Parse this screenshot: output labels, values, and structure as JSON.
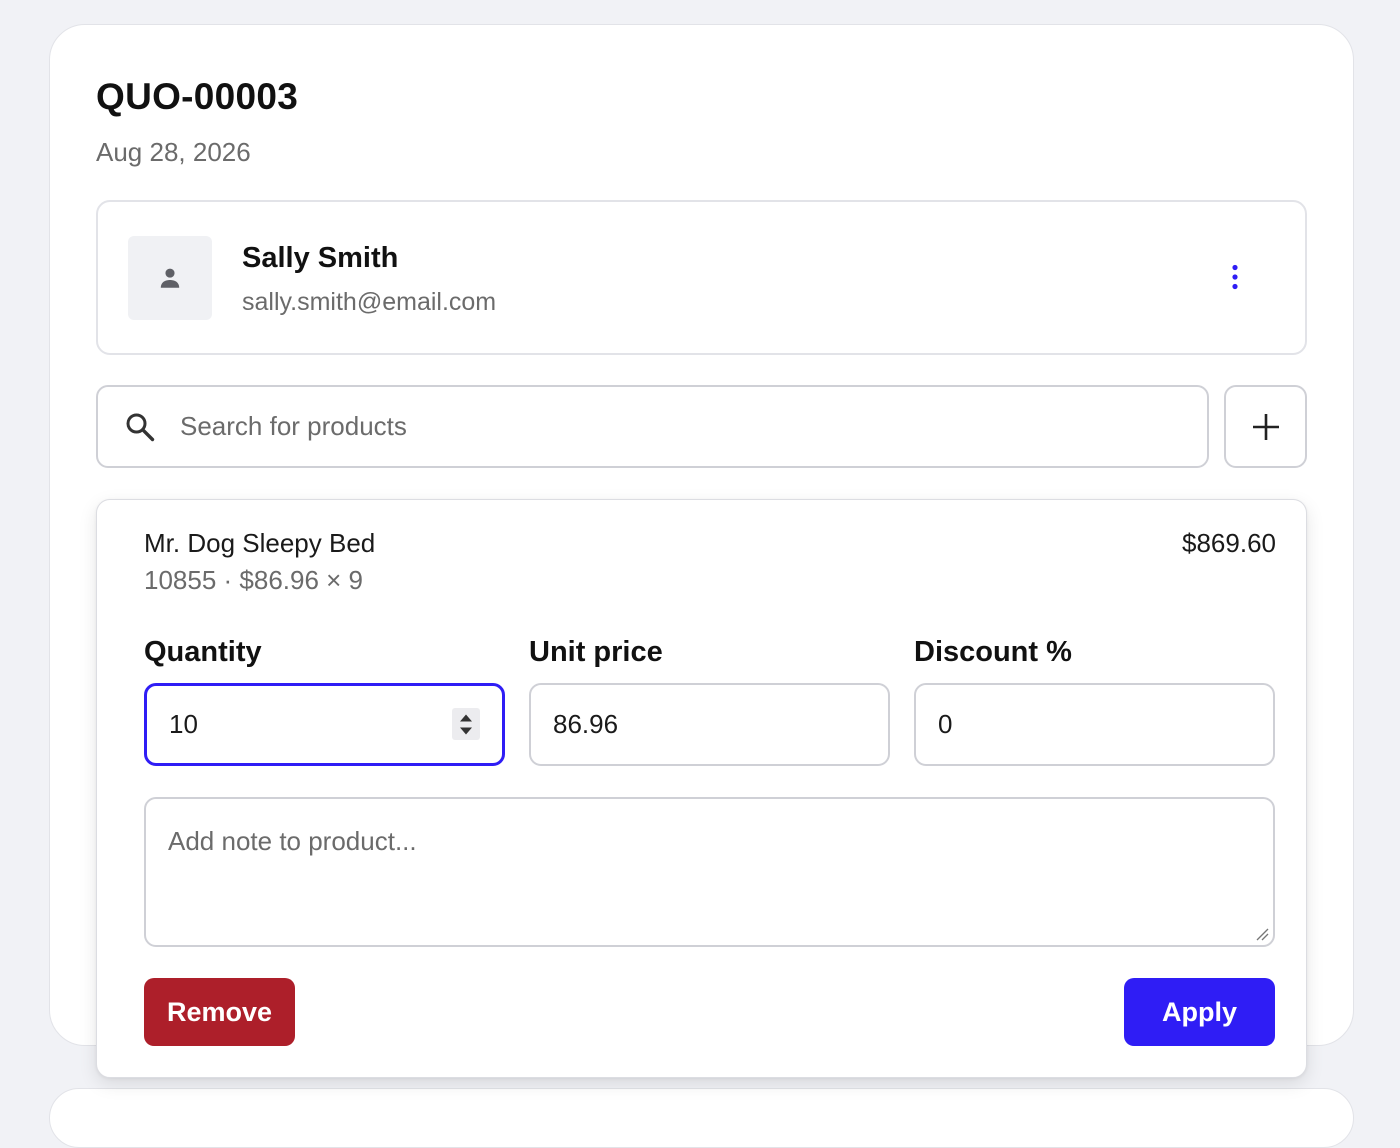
{
  "quote": {
    "number": "QUO-00003",
    "date": "Aug 28, 2026"
  },
  "customer": {
    "name": "Sally Smith",
    "email": "sally.smith@email.com"
  },
  "search": {
    "placeholder": "Search for products"
  },
  "line_item": {
    "name": "Mr. Dog Sleepy Bed",
    "meta": "10855 · $86.96 × 9",
    "total": "$869.60",
    "quantity_label": "Quantity",
    "quantity_value": "10",
    "unit_price_label": "Unit price",
    "unit_price_value": "86.96",
    "discount_label": "Discount %",
    "discount_value": "0",
    "note_placeholder": "Add note to product...",
    "remove_label": "Remove",
    "apply_label": "Apply"
  },
  "colors": {
    "accent": "#2f1df5",
    "danger": "#ad1f2a",
    "page_background": "#f1f2f6"
  },
  "icons": {
    "avatar": "person-icon",
    "more": "more-vertical-icon",
    "search": "search-icon",
    "add": "plus-icon",
    "stepper": "stepper-arrows-icon"
  }
}
